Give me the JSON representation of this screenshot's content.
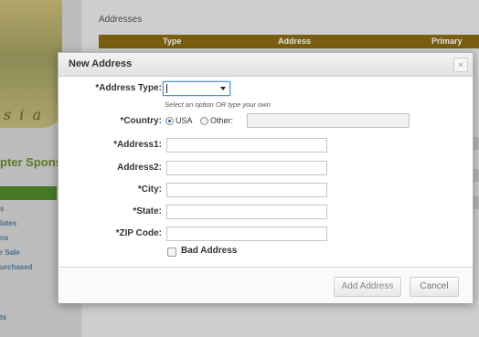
{
  "background": {
    "sidebar_crest_script": "s i a",
    "sidebar_title": "pter Spons",
    "nav_items": [
      "s",
      "lates",
      "ns",
      "r Sale",
      "urchased"
    ],
    "nav_last": "ts",
    "addresses_title": "Addresses",
    "table_headers": {
      "type": "Type",
      "address": "Address",
      "primary": "Primary"
    }
  },
  "modal": {
    "title": "New Address",
    "close_glyph": "×",
    "address_type": {
      "label": "*Address Type:",
      "hint": "Select an option OR type your own"
    },
    "country": {
      "label": "*Country:",
      "usa_label": "USA",
      "other_label": "Other:",
      "selected": "USA"
    },
    "fields": [
      {
        "label": "*Address1:"
      },
      {
        "label": "Address2:"
      },
      {
        "label": "*City:"
      },
      {
        "label": "*State:"
      },
      {
        "label": "*ZIP Code:"
      }
    ],
    "bad_address_label": "Bad Address",
    "add_button": "Add Address",
    "cancel_button": "Cancel"
  },
  "colors": {
    "header_bar": "#8a6a14",
    "sidebar_green": "#4f8a2c",
    "focus_blue": "#4d8fd6"
  }
}
